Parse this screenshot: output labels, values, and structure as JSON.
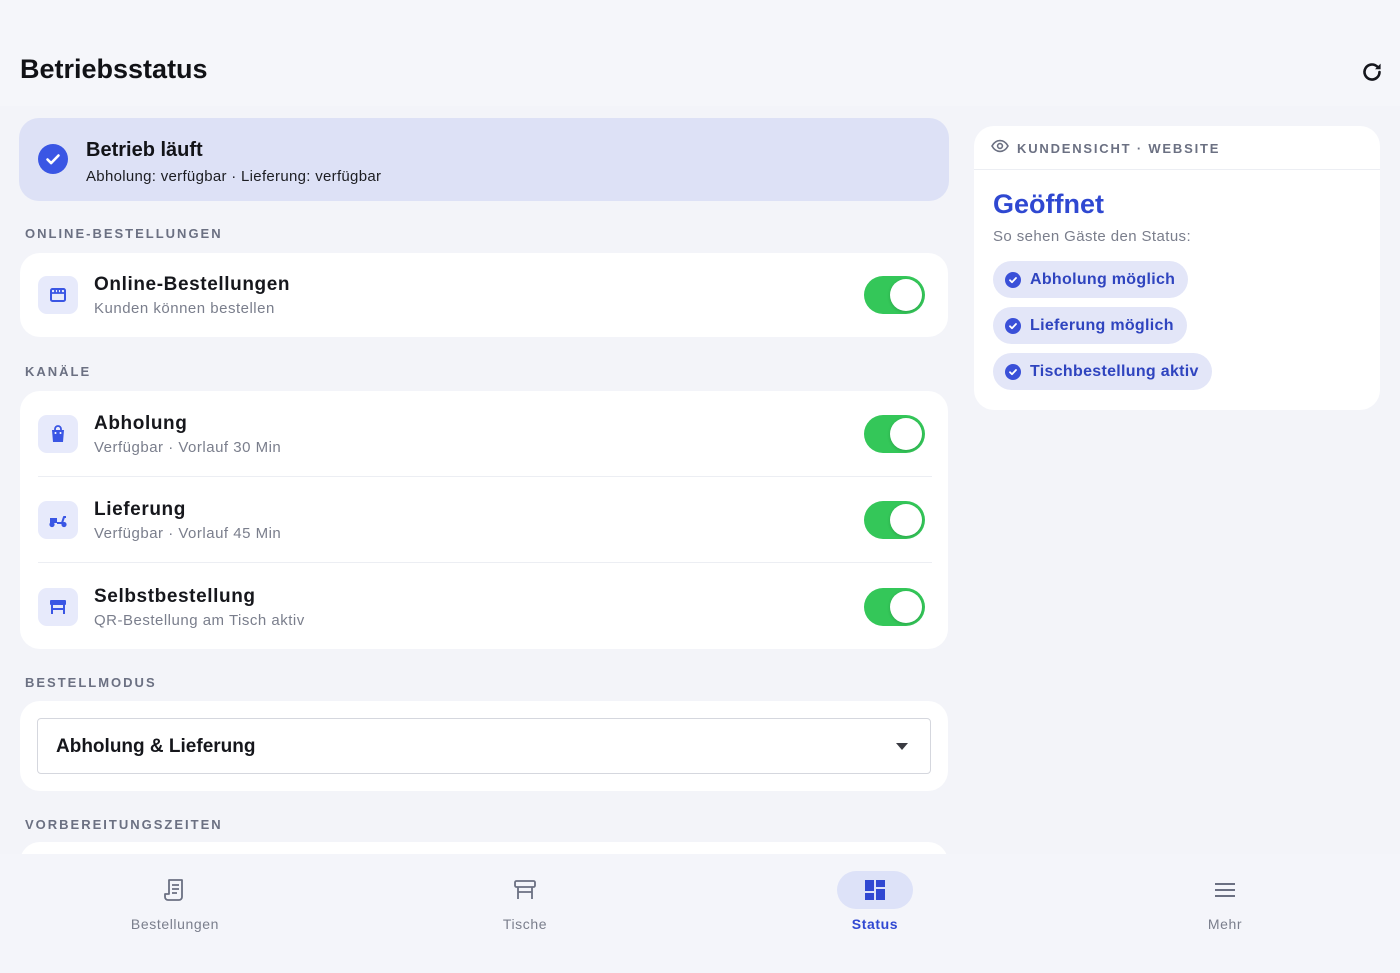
{
  "header": {
    "title": "Betriebsstatus",
    "refresh_icon": "refresh-icon"
  },
  "banner": {
    "title": "Betrieb läuft",
    "subtitle": "Abholung: verfügbar · Lieferung: verfügbar",
    "icon": "check-circle-icon"
  },
  "sections": {
    "online": {
      "label": "ONLINE-BESTELLUNGEN",
      "row": {
        "title": "Online-Bestellungen",
        "subtitle": "Kunden können bestellen",
        "icon": "storefront-icon",
        "enabled": true
      }
    },
    "channels": {
      "label": "KANÄLE",
      "rows": [
        {
          "title": "Abholung",
          "subtitle": "Verfügbar · Vorlauf 30 Min",
          "icon": "shopping-bag-icon",
          "enabled": true
        },
        {
          "title": "Lieferung",
          "subtitle": "Verfügbar · Vorlauf 45 Min",
          "icon": "scooter-icon",
          "enabled": true
        },
        {
          "title": "Selbstbestellung",
          "subtitle": "QR-Bestellung am Tisch aktiv",
          "icon": "table-icon",
          "enabled": true
        }
      ]
    },
    "order_mode": {
      "label": "BESTELLMODUS",
      "selected": "Abholung & Lieferung"
    },
    "prep_times": {
      "label": "VORBEREITUNGSZEITEN"
    }
  },
  "customer_view": {
    "header": "KUNDENSICHT · WEBSITE",
    "status": "Geöffnet",
    "subtitle": "So sehen Gäste den Status:",
    "pills": [
      "Abholung möglich",
      "Lieferung möglich",
      "Tischbestellung aktiv"
    ]
  },
  "nav": {
    "items": [
      {
        "label": "Bestellungen",
        "icon": "receipt-icon",
        "active": false
      },
      {
        "label": "Tische",
        "icon": "table-icon",
        "active": false
      },
      {
        "label": "Status",
        "icon": "dashboard-icon",
        "active": true
      },
      {
        "label": "Mehr",
        "icon": "menu-icon",
        "active": false
      }
    ]
  },
  "colors": {
    "accent": "#3a56e4",
    "toggle_on": "#34c759",
    "banner_bg": "#dde1f6",
    "page_bg": "#f3f4f9"
  }
}
